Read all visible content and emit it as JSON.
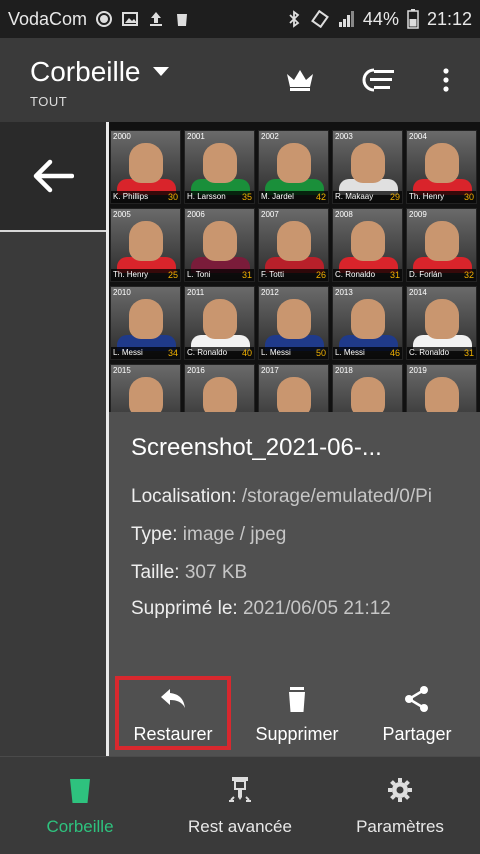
{
  "status_bar": {
    "carrier": "VodaCom",
    "battery": "44%",
    "time": "21:12",
    "icons": [
      "circle-icon",
      "image-icon",
      "upload-icon",
      "trash-icon",
      "bluetooth-icon",
      "rotate-icon",
      "signal-icon",
      "battery-icon"
    ]
  },
  "app_bar": {
    "title": "Corbeille",
    "subtitle": "TOUT",
    "icons": [
      "crown-icon",
      "sort-icon",
      "more-vert-icon"
    ]
  },
  "thumbnail": {
    "cards": [
      {
        "year": "2000",
        "name": "K. Phillips",
        "num": "30",
        "color": "#d9242b"
      },
      {
        "year": "2001",
        "name": "H. Larsson",
        "num": "35",
        "color": "#1a8f3a"
      },
      {
        "year": "2002",
        "name": "M. Jardel",
        "num": "42",
        "color": "#1a8f3a"
      },
      {
        "year": "2003",
        "name": "R. Makaay",
        "num": "29",
        "color": "#e0e0e0"
      },
      {
        "year": "2004",
        "name": "Th. Henry",
        "num": "30",
        "color": "#d9242b"
      },
      {
        "year": "2005",
        "name": "Th. Henry",
        "num": "25",
        "color": "#d9242b"
      },
      {
        "year": "2006",
        "name": "L. Toni",
        "num": "31",
        "color": "#7a1c3a"
      },
      {
        "year": "2007",
        "name": "F. Totti",
        "num": "26",
        "color": "#b8202a"
      },
      {
        "year": "2008",
        "name": "C. Ronaldo",
        "num": "31",
        "color": "#d9242b"
      },
      {
        "year": "2009",
        "name": "D. Forlán",
        "num": "32",
        "color": "#d9242b"
      },
      {
        "year": "2010",
        "name": "L. Messi",
        "num": "34",
        "color": "#1f3a8a"
      },
      {
        "year": "2011",
        "name": "C. Ronaldo",
        "num": "40",
        "color": "#f2f2f2"
      },
      {
        "year": "2012",
        "name": "L. Messi",
        "num": "50",
        "color": "#1f3a8a"
      },
      {
        "year": "2013",
        "name": "L. Messi",
        "num": "46",
        "color": "#1f3a8a"
      },
      {
        "year": "2014",
        "name": "C. Ronaldo",
        "num": "31",
        "color": "#f2f2f2"
      },
      {
        "year": "2015",
        "name": "",
        "num": "",
        "color": "#f2f2f2"
      },
      {
        "year": "2016",
        "name": "",
        "num": "",
        "color": "#1f3a8a"
      },
      {
        "year": "2017",
        "name": "",
        "num": "",
        "color": "#1f3a8a"
      },
      {
        "year": "2018",
        "name": "",
        "num": "",
        "color": "#1f3a8a"
      },
      {
        "year": "2019",
        "name": "",
        "num": "",
        "color": "#1f3a8a"
      }
    ]
  },
  "file": {
    "name": "Screenshot_2021-06-...",
    "location_label": "Localisation:",
    "location_value": "/storage/emulated/0/Pi",
    "type_label": "Type:",
    "type_value": "image / jpeg",
    "size_label": "Taille:",
    "size_value": "307 KB",
    "deleted_label": "Supprimé le:",
    "deleted_value": "2021/06/05 21:12"
  },
  "actions": {
    "restore": "Restaurer",
    "delete": "Supprimer",
    "share": "Partager"
  },
  "bottom_nav": {
    "tabs": [
      {
        "label": "Corbeille",
        "icon": "trash-bin-icon",
        "active": true
      },
      {
        "label": "Rest avancée",
        "icon": "drill-icon",
        "active": false
      },
      {
        "label": "Paramètres",
        "icon": "gear-icon",
        "active": false
      }
    ]
  },
  "colors": {
    "accent": "#2ec27e",
    "highlight": "#d8282e",
    "panel": "#505050",
    "background": "#3a3a3a"
  }
}
